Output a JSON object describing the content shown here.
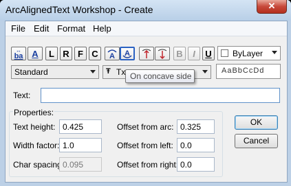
{
  "window": {
    "title": "ArcAlignedText Workshop - Create",
    "close_glyph": "✕"
  },
  "menu": [
    "File",
    "Edit",
    "Format",
    "Help"
  ],
  "toolbar": {
    "reverse_label": "ba",
    "underline_text_label": "A",
    "left_label": "L",
    "right_label": "R",
    "fit_label": "F",
    "center_label": "C",
    "bold_label": "B",
    "italic_label": "I",
    "underline_label": "U",
    "color": "ByLayer"
  },
  "style_combo": "Standard",
  "font_combo": "Txt",
  "preview_text": "AaBbCcDd",
  "tooltip": "On concave side",
  "text_label": "Text:",
  "text_value": "",
  "properties": {
    "heading": "Properties:",
    "text_height_label": "Text height:",
    "text_height": "0.425",
    "width_factor_label": "Width factor:",
    "width_factor": "1.0",
    "char_spacing_label": "Char spacing:",
    "char_spacing": "0.095",
    "offset_arc_label": "Offset from arc:",
    "offset_arc": "0.325",
    "offset_left_label": "Offset from left:",
    "offset_left": "0.0",
    "offset_right_label": "Offset from right:",
    "offset_right": "0.0"
  },
  "buttons": {
    "ok": "OK",
    "cancel": "Cancel"
  }
}
